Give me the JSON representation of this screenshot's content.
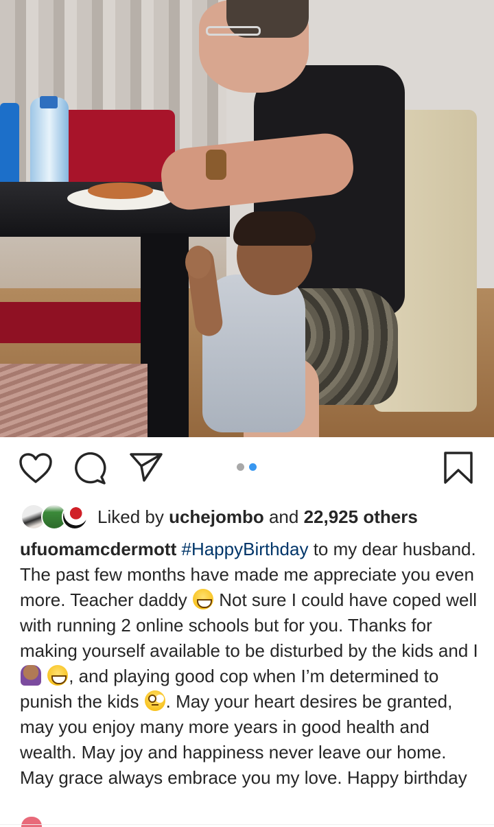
{
  "post": {
    "image": {
      "description_icon": "photo"
    },
    "carousel": {
      "count": 2,
      "active_index": 2
    },
    "likes": {
      "prefix": "Liked by ",
      "liked_by_user": "uchejombo",
      "middle": " and ",
      "others_count": "22,925 others"
    },
    "caption": {
      "username": "ufuomamcdermott",
      "hashtag": "#HappyBirthday",
      "text_1": " to my dear husband. The past few months have made me appreciate you even more. Teacher daddy ",
      "text_2": " Not sure I could have coped well with running 2 online schools but for you. Thanks for making yourself available to be disturbed by the kids and I ",
      "text_3": ", and playing good cop when I’m determined to punish the kids ",
      "text_4": ". May your heart desires be granted, may you enjoy many more years in good health and wealth. May joy and happiness never leave our home. May grace always embrace you my love. Happy birthday"
    }
  },
  "icons": {
    "like": "heart-outline-icon",
    "comment": "speech-bubble-icon",
    "share": "paper-plane-icon",
    "save": "bookmark-icon"
  },
  "colors": {
    "hashtag": "#003569",
    "active_dot": "#3897f0",
    "inactive_dot": "#a8a8a8"
  }
}
